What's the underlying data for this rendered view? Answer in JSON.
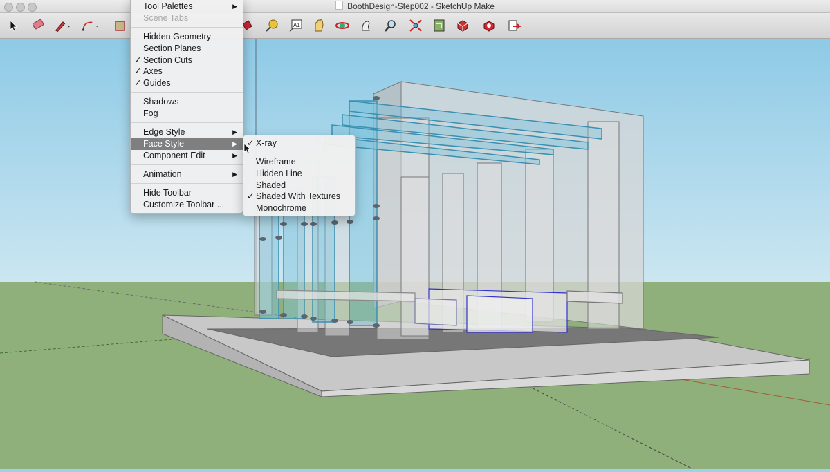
{
  "window": {
    "title": "BoothDesign-Step002 - SketchUp Make"
  },
  "toolbar": {
    "tools": [
      "select-icon",
      "eraser-icon",
      "pencil-icon",
      "arc-icon",
      "rectangle-icon",
      "paint-bucket-icon",
      "tape-measure-icon",
      "text-label-icon",
      "pan-icon",
      "orbit-icon",
      "walk-icon",
      "zoom-icon",
      "zoom-extents-icon",
      "previous-view-icon",
      "3d-warehouse-icon",
      "extension-warehouse-icon",
      "send-to-layout-icon"
    ]
  },
  "view_menu": {
    "items": [
      {
        "label": "Tool Palettes",
        "submenu": true
      },
      {
        "label": "Scene Tabs",
        "disabled": true
      },
      {
        "label": "Hidden Geometry"
      },
      {
        "label": "Section Planes"
      },
      {
        "label": "Section Cuts",
        "checked": true
      },
      {
        "label": "Axes",
        "checked": true
      },
      {
        "label": "Guides",
        "checked": true
      },
      {
        "label": "Shadows"
      },
      {
        "label": "Fog"
      },
      {
        "label": "Edge Style",
        "submenu": true
      },
      {
        "label": "Face Style",
        "submenu": true,
        "highlighted": true
      },
      {
        "label": "Component Edit",
        "submenu": true
      },
      {
        "label": "Animation",
        "submenu": true
      },
      {
        "label": "Hide Toolbar"
      },
      {
        "label": "Customize Toolbar ..."
      }
    ]
  },
  "face_style_submenu": {
    "items": [
      {
        "label": "X-ray",
        "checked": true
      },
      {
        "label": "Wireframe"
      },
      {
        "label": "Hidden Line"
      },
      {
        "label": "Shaded"
      },
      {
        "label": "Shaded With Textures",
        "checked": true
      },
      {
        "label": "Monochrome"
      }
    ]
  },
  "glyphs": {
    "check": "✓",
    "submenu_arrow": "▶"
  },
  "colors": {
    "sky": "#9bd1ea",
    "ground": "#8fb07a",
    "glass": "#7ec3dc",
    "highlight": "#7f7f7f",
    "selection": "#3333cc"
  }
}
